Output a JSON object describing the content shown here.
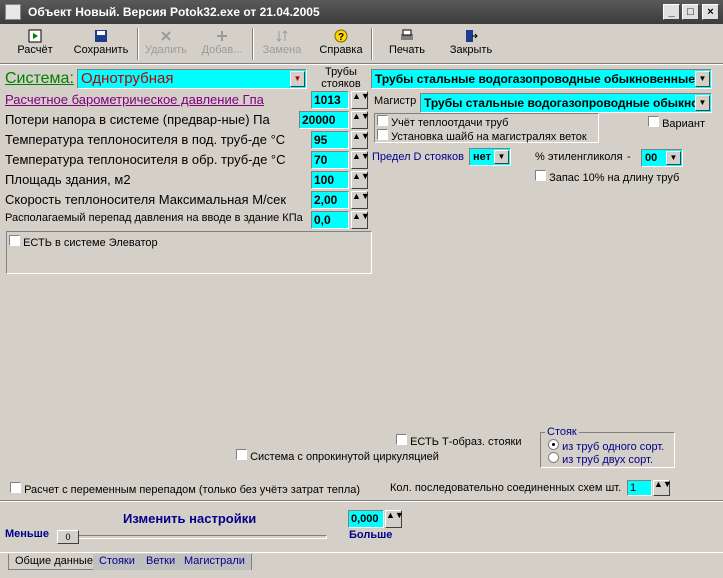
{
  "window": {
    "title": "Объект Новый. Версия Potok32.exe от 21.04.2005",
    "minimize": "_",
    "maximize": "□",
    "close": "×"
  },
  "toolbar": {
    "calc": "Расчёт",
    "save": "Сохранить",
    "delete": "Удалить",
    "add": "Добав...",
    "replace": "Замена",
    "help": "Справка",
    "print": "Печать",
    "close": "Закрыть"
  },
  "system": {
    "label": "Система:",
    "value": "Однотрубная"
  },
  "risers_pipes": {
    "label": "Трубы стояков",
    "value": "Трубы стальные водогазопроводные обыкновенные"
  },
  "main_pipes": {
    "label": "Магистр",
    "value": "Трубы стальные водогазопроводные обыкно"
  },
  "params": [
    {
      "label": "Расчетное барометрическое давление  Гпа",
      "value": "1013"
    },
    {
      "label": "Потери напора в системе (предвар-ные)  Па",
      "value": "20000"
    },
    {
      "label": "Температура теплоносителя в под. труб-де  °С",
      "value": "95"
    },
    {
      "label": "Температура теплоносителя в обр. труб-де °С",
      "value": "70"
    },
    {
      "label": "Площадь здания, м2",
      "value": "100"
    },
    {
      "label": "Скорость теплоносителя Максимальная М/сек",
      "value": "2,00"
    },
    {
      "label": "Располагаемый перепад давления на вводе  в здание  КПа",
      "value": "0,0"
    }
  ],
  "spin_glyph": "▲▼",
  "elevator": {
    "label": "ЕСТЬ в системе Элеватор"
  },
  "pipe_heat": {
    "label": "Учёт теплоотдачи труб"
  },
  "washers": {
    "label": "Установка шайб на магистралях веток"
  },
  "variant": {
    "label": "Вариант"
  },
  "riser_d": {
    "label": "Предел D стояков",
    "value": "нет"
  },
  "glycol": {
    "label": "% этиленгликоля",
    "dash": "-",
    "value": "00"
  },
  "reserve": {
    "label": "Запас 10% на длину труб"
  },
  "t_risers": {
    "label": "ЕСТЬ Т-образ. стояки"
  },
  "overturned": {
    "label": "Система с опрокинутой циркуляцией"
  },
  "riser_group": {
    "title": "Стояк",
    "opt1": "из труб одного сорт.",
    "opt2": "из труб двух сорт."
  },
  "variable_drop": {
    "label": "Расчет с переменным перепадом (только без учётэ затрат тепла)"
  },
  "series_count": {
    "label": "Кол. последовательно соединенных схем шт.",
    "value": "1"
  },
  "settings": {
    "title": "Изменить настройки",
    "less": "Меньше",
    "more": "Больше",
    "slider_value": "0",
    "value": "0,000"
  },
  "tabs": [
    "Общие данные",
    "Стояки",
    "Ветки",
    "Магистрали"
  ]
}
